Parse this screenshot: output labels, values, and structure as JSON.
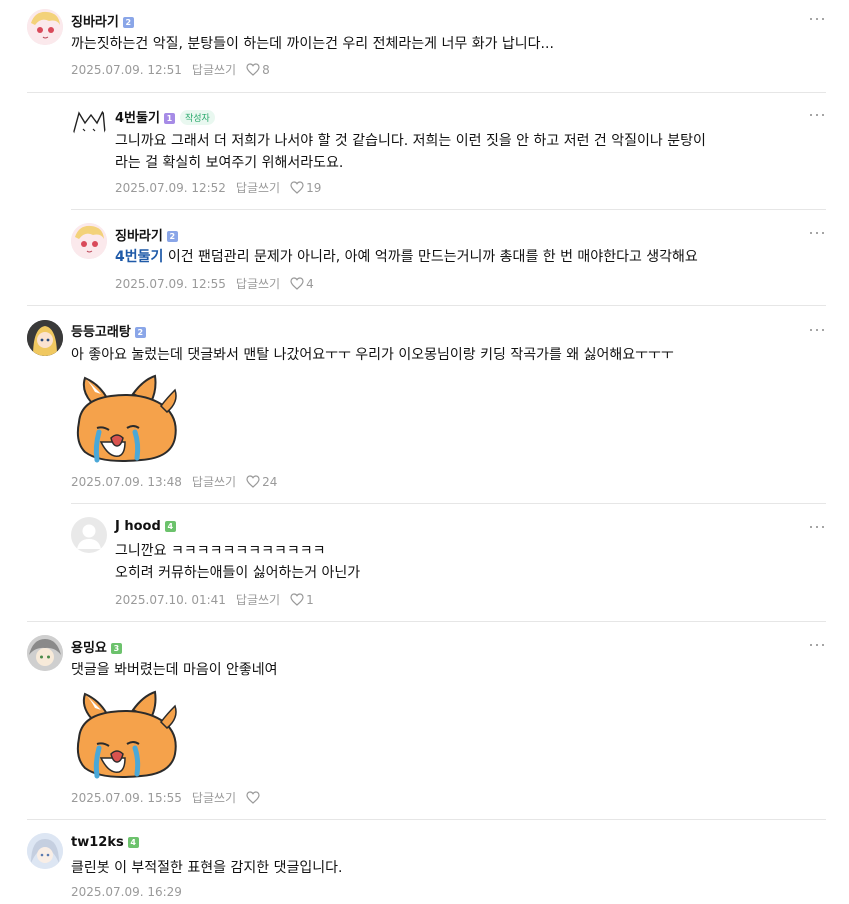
{
  "comments": [
    {
      "author": "징바라기",
      "level": "2",
      "text": "까는짓하는건 악질, 분탕들이 하는데 까이는건 우리 전체라는게 너무 화가 납니다...",
      "date": "2025.07.09. 12:51",
      "reply_label": "답글쓰기",
      "likes": "8"
    },
    {
      "author": "4번둘기",
      "level": "1",
      "badge": "작성자",
      "text_line1": "그니까요 그래서 더 저희가 나서야 할 것 같습니다. 저희는 이런 짓을 안 하고 저런 건 악질이나 분탕이",
      "text_line2": "라는 걸 확실히 보여주기 위해서라도요.",
      "date": "2025.07.09. 12:52",
      "reply_label": "답글쓰기",
      "likes": "19"
    },
    {
      "author": "징바라기",
      "level": "2",
      "mention": "4번둘기",
      "text": " 이건 팬덤관리 문제가 아니라, 아예 억까를 만드는거니까 총대를 한 번 매야한다고 생각해요",
      "date": "2025.07.09. 12:55",
      "reply_label": "답글쓰기",
      "likes": "4"
    },
    {
      "author": "등등고래탕",
      "level": "2",
      "text": "아 좋아요 눌렀는데 댓글봐서 맨탈 나갔어요ㅜㅜ 우리가 이오몽님이랑 키딩 작곡가를 왜 싫어해요ㅜㅜㅜ",
      "date": "2025.07.09. 13:48",
      "reply_label": "답글쓰기",
      "likes": "24"
    },
    {
      "author": "J hood",
      "level": "4",
      "text_line1": "그니깐요 ㅋㅋㅋㅋㅋㅋㅋㅋㅋㅋㅋㅋ",
      "text_line2": "오히려 커뮤하는애들이 싫어하는거 아닌가",
      "date": "2025.07.10. 01:41",
      "reply_label": "답글쓰기",
      "likes": "1"
    },
    {
      "author": "용밍요",
      "level": "3",
      "text": "댓글을 봐버렸는데 마음이 안좋네여",
      "date": "2025.07.09. 15:55",
      "reply_label": "답글쓰기",
      "likes": ""
    },
    {
      "author": "tw12ks",
      "level": "4",
      "text": "클린봇 이 부적절한 표현을 감지한 댓글입니다.",
      "date": "2025.07.09. 16:29"
    }
  ],
  "colors": {
    "mention": "#1f5aa8",
    "writer_badge": "#27a86a",
    "meta": "#9a9a9a",
    "level_blue": "#8aa6e8",
    "level_purple": "#a68be6",
    "level_green": "#6cc26c"
  },
  "icons": [
    "more-options-icon",
    "heart-icon",
    "fox-crying-sticker",
    "default-profile-icon"
  ]
}
